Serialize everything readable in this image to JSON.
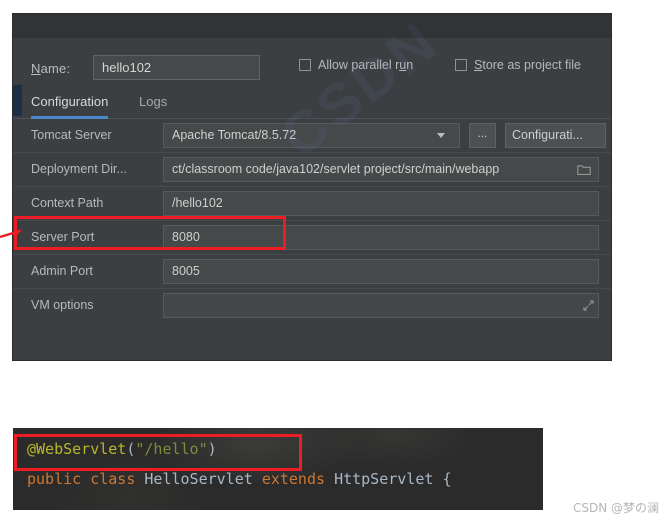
{
  "dialog": {
    "name_field": {
      "label": "Name:",
      "mnemonic": "N",
      "label_rest": "ame:",
      "value": "hello102"
    },
    "checkboxes": [
      {
        "name": "allow-parallel-run",
        "label_before": "Allow parallel r",
        "mnemonic": "u",
        "label_after": "n",
        "full_label": "Allow parallel run",
        "checked": false
      },
      {
        "name": "store-as-project-file",
        "label_before": "",
        "mnemonic": "S",
        "label_after": "tore as project file",
        "full_label": "Store as project file",
        "checked": false
      }
    ],
    "gear_icon": "gear-icon",
    "tabs": [
      {
        "label": "Configuration",
        "active": true
      },
      {
        "label": "Logs",
        "active": false
      }
    ],
    "rows": [
      {
        "label": "Tomcat Server",
        "value": "Apache Tomcat/8.5.72",
        "browse_label": "...",
        "configure_label": "Configurati..."
      },
      {
        "label": "Deployment Dir...",
        "value": "ct/classroom code/java102/servlet project/src/main/webapp",
        "icon": "folder-icon"
      },
      {
        "label": "Context Path",
        "value": "/hello102"
      },
      {
        "label": "Server Port",
        "value": "8080"
      },
      {
        "label": "Admin Port",
        "value": "8005"
      },
      {
        "label": "VM options",
        "value": "",
        "icon": "expand-icon"
      }
    ],
    "watermark": "CSDN"
  },
  "code": {
    "line1": {
      "annotation": "@WebServlet",
      "open_paren": "(",
      "string": "\"/hello\"",
      "close_paren": ")"
    },
    "line2": {
      "kw_public": "public",
      "kw_class": "class",
      "type_name": "HelloServlet",
      "kw_extends": "extends",
      "super_type": "HttpServlet",
      "brace": "{"
    },
    "line3": ""
  },
  "annotations": {
    "context_path_highlight_color": "#ee1c24",
    "code_highlight_color": "#ee1c24",
    "tab_accent_color": "#4a88c7"
  },
  "footer": {
    "watermark": "CSDN @梦の澜"
  }
}
